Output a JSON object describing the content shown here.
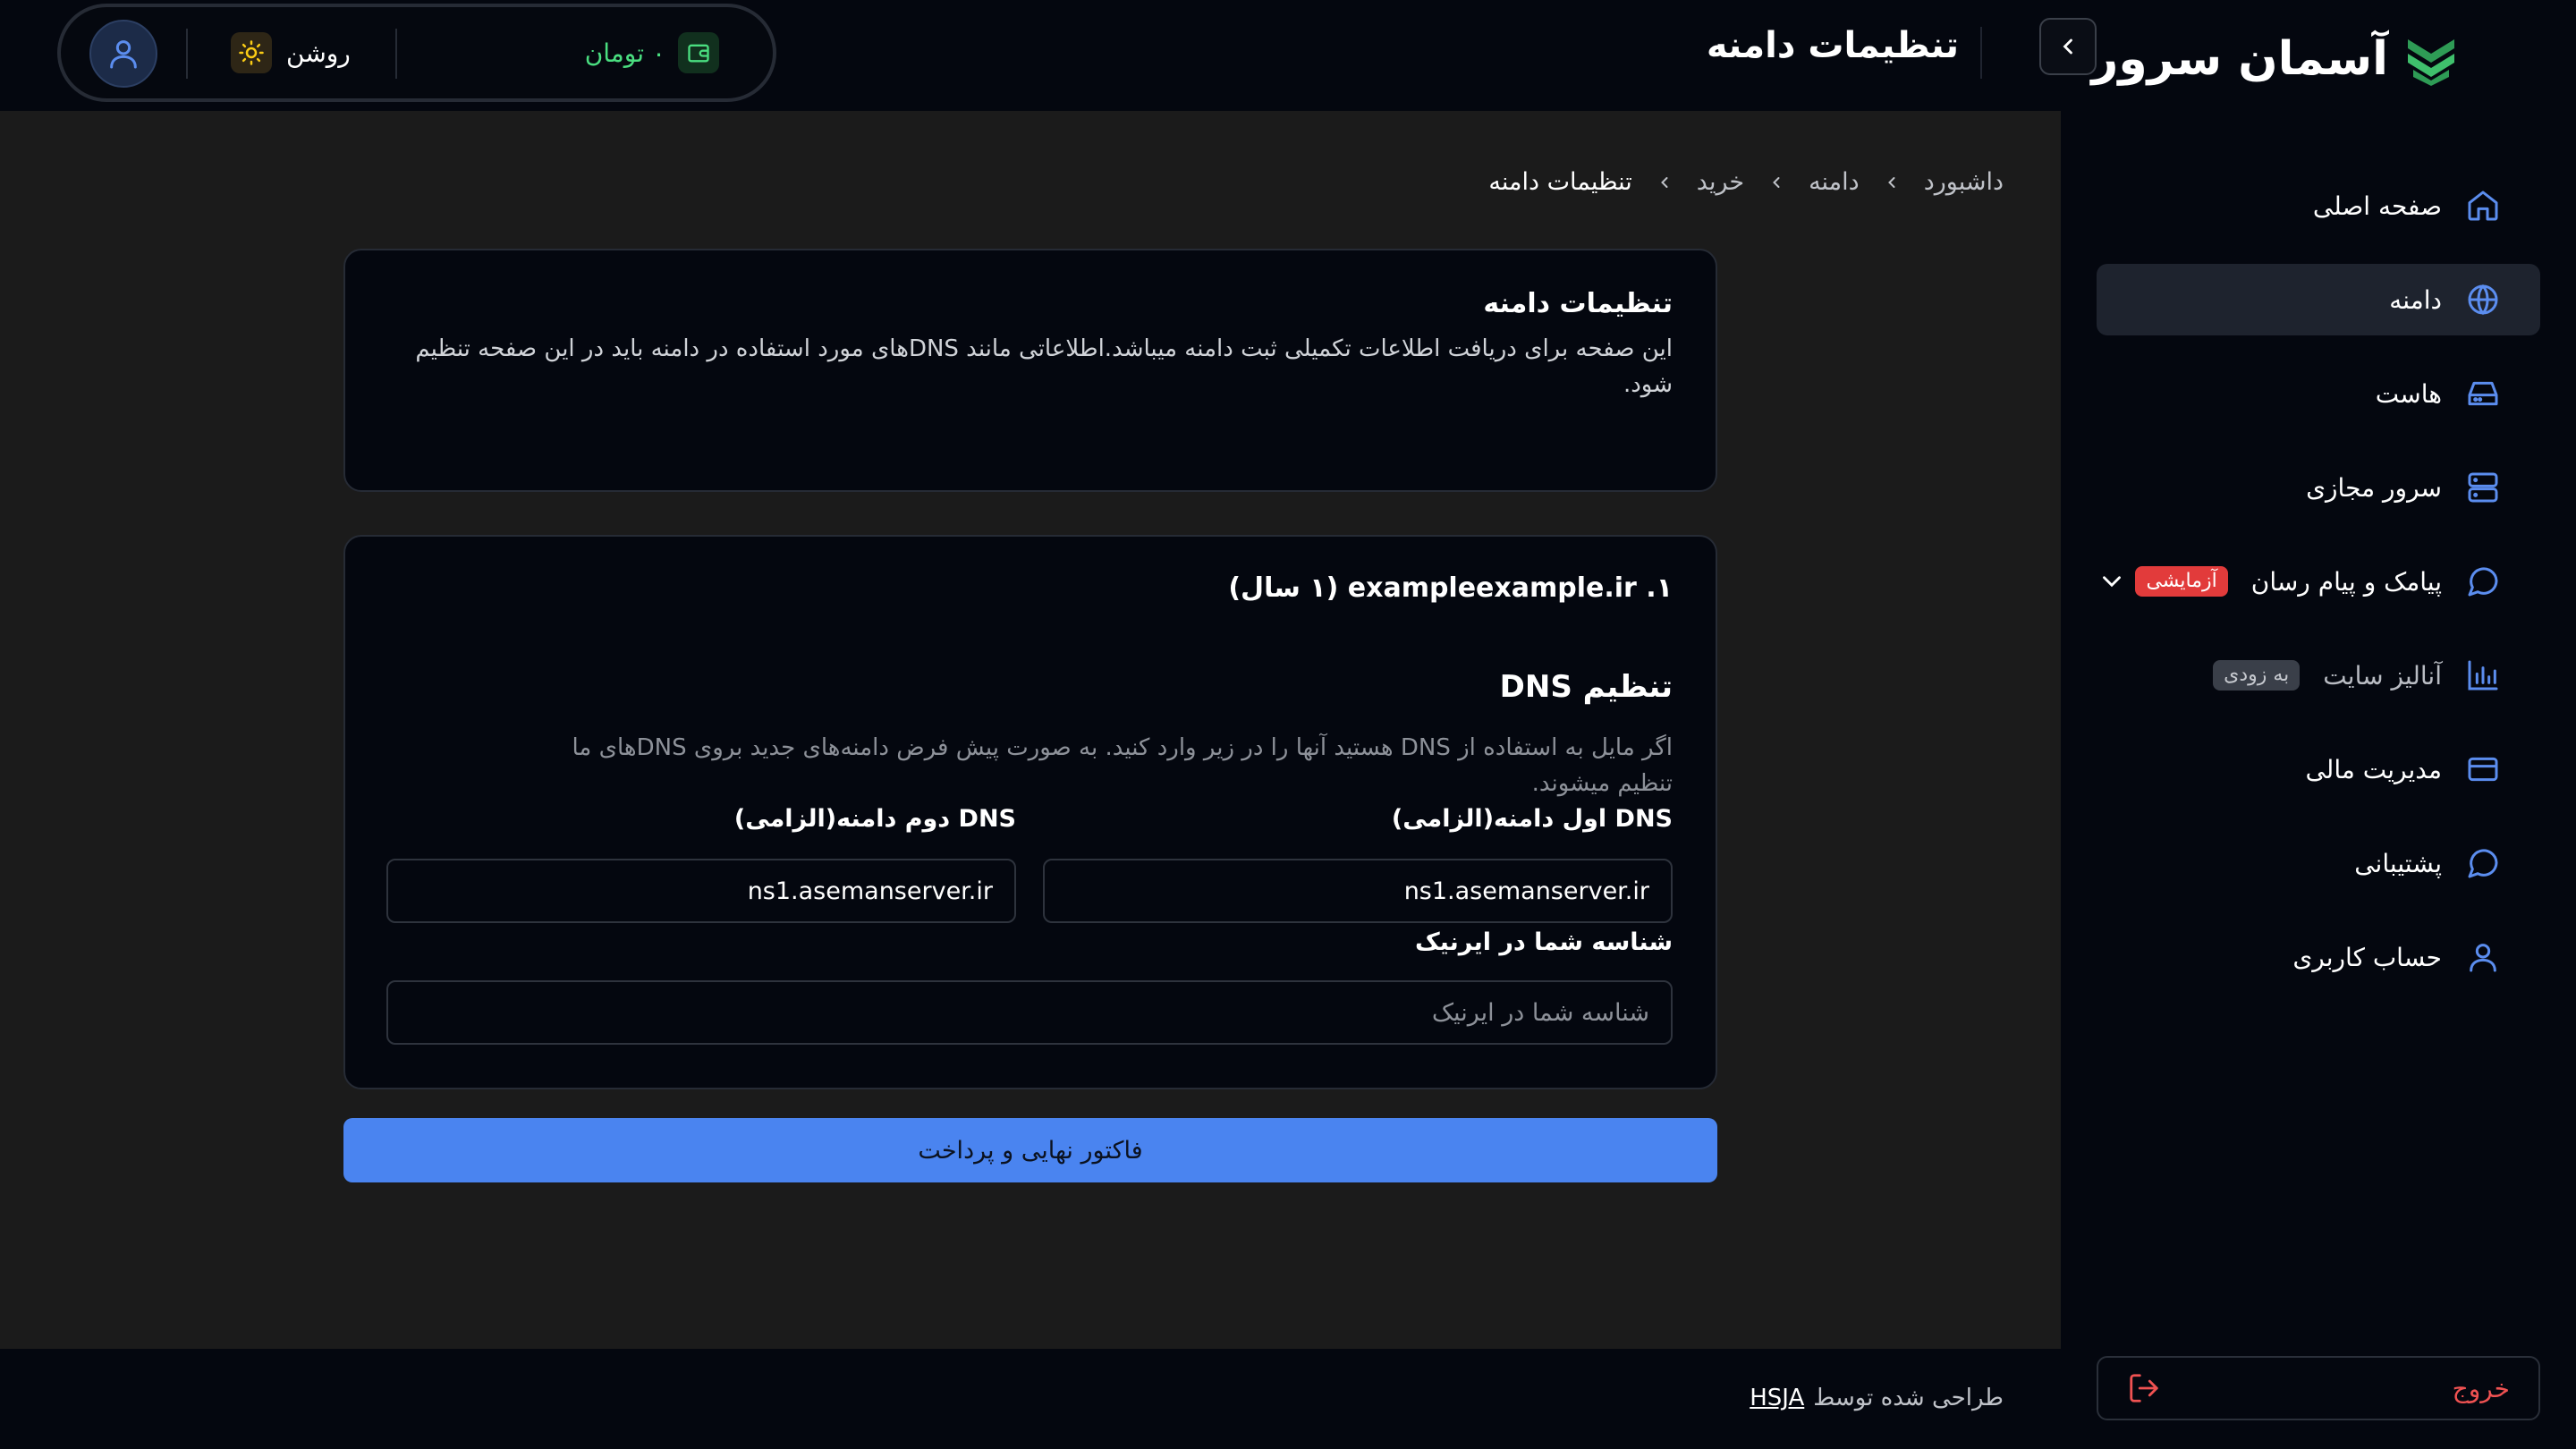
{
  "brand": {
    "name": "آسمان سرور"
  },
  "header": {
    "title": "تنظیمات دامنه",
    "wallet": "۰ تومان",
    "theme": "روشن"
  },
  "sidebar": {
    "items": [
      {
        "label": "صفحه اصلی",
        "icon": "home-icon"
      },
      {
        "label": "دامنه",
        "icon": "globe-icon",
        "active": true
      },
      {
        "label": "هاست",
        "icon": "hard-drive-icon"
      },
      {
        "label": "سرور مجازی",
        "icon": "server-icon"
      },
      {
        "label": "پیامک و پیام رسان",
        "icon": "message-icon",
        "badge": "آزمایشی"
      },
      {
        "label": "آنالیز سایت",
        "icon": "bar-chart-icon",
        "badge": "به زودی"
      },
      {
        "label": "مدیریت مالی",
        "icon": "credit-card-icon"
      },
      {
        "label": "پشتیبانی",
        "icon": "support-chat-icon"
      },
      {
        "label": "حساب کاربری",
        "icon": "user-icon"
      }
    ],
    "logout": "خروج"
  },
  "breadcrumb": [
    "داشبورد",
    "دامنه",
    "خرید",
    "تنظیمات دامنه"
  ],
  "intro": {
    "title": "تنظیمات دامنه",
    "text": "این صفحه برای دریافت اطلاعات تکمیلی ثبت دامنه میباشد.اطلاعاتی مانند DNSهای مورد استفاده در دامنه باید در این صفحه تنظیم شود."
  },
  "domain_card": {
    "title": "۱. exampleexample.ir (۱ سال)",
    "dns_heading": "تنظیم DNS",
    "dns_help": "اگر مایل به استفاده از DNS هستید آنها را در زیر وارد کنید. به صورت پیش فرض دامنه‌های جدید بروی DNSهای ما تنظیم میشوند.",
    "dns1_label": "DNS اول دامنه(الزامی)",
    "dns1_value": "ns1.asemanserver.ir",
    "dns2_label": "DNS دوم دامنه(الزامی)",
    "dns2_value": "ns1.asemanserver.ir",
    "irnic_label": "شناسه شما در ایرنیک",
    "irnic_placeholder": "شناسه شما در ایرنیک"
  },
  "submit_label": "فاکتور نهایی و پرداخت",
  "footer": {
    "text": "طراحی شده توسط",
    "link": "HSJA"
  },
  "colors": {
    "accent": "#4a84f0",
    "sidebar_bg": "#04070f",
    "page_bg": "#1b1b1b",
    "danger": "#f05252",
    "wallet_green": "#4ade80"
  }
}
